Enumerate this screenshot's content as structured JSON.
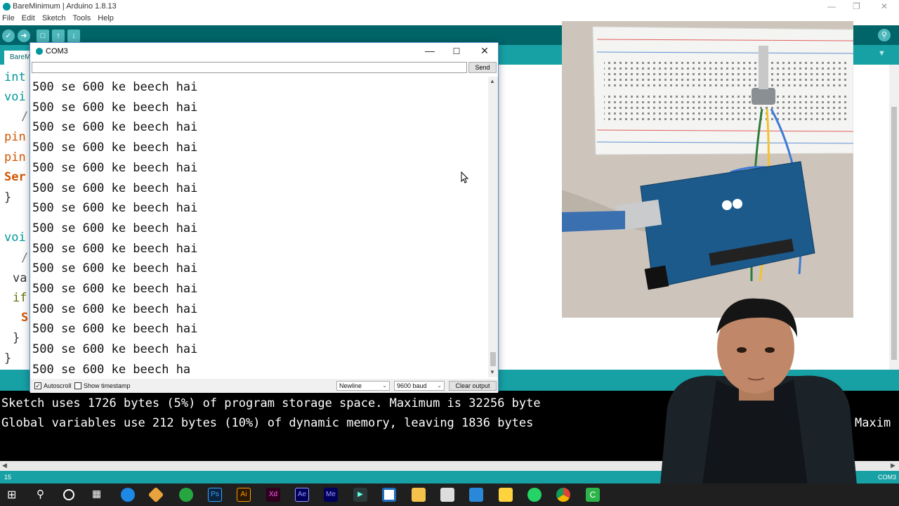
{
  "ide": {
    "window_title": "BareMinimum | Arduino 1.8.13",
    "menu": [
      "File",
      "Edit",
      "Sketch",
      "Tools",
      "Help"
    ],
    "tab_label": "BareMi",
    "code_fragments": [
      "int",
      "voi",
      "/",
      "pin",
      "pin",
      "Ser",
      "}",
      "voi",
      "/",
      "va",
      "if",
      "S",
      "}",
      "}"
    ],
    "console_lines": [
      "Sketch uses 1726 bytes (5%) of program storage space. Maximum is 32256 byte",
      "Global variables use 212 bytes (10%) of dynamic memory, leaving 1836 bytes",
      "Maxim"
    ],
    "status_line_number": "15",
    "status_port": "COM3",
    "accent_color": "#00979c",
    "toolbar_color": "#006468"
  },
  "serial_monitor": {
    "window_title": "COM3",
    "input_value": "",
    "send_label": "Send",
    "output_lines": [
      "500 se 600 ke beech hai",
      "500 se 600 ke beech hai",
      "500 se 600 ke beech hai",
      "500 se 600 ke beech hai",
      "500 se 600 ke beech hai",
      "500 se 600 ke beech hai",
      "500 se 600 ke beech hai",
      "500 se 600 ke beech hai",
      "500 se 600 ke beech hai",
      "500 se 600 ke beech hai",
      "500 se 600 ke beech hai",
      "500 se 600 ke beech hai",
      "500 se 600 ke beech hai",
      "500 se 600 ke beech hai",
      "500 se 600 ke beech ha"
    ],
    "autoscroll_label": "Autoscroll",
    "autoscroll_checked": true,
    "show_timestamp_label": "Show timestamp",
    "show_timestamp_checked": false,
    "line_ending": "Newline",
    "baud_rate": "9600 baud",
    "clear_label": "Clear output"
  },
  "taskbar": {
    "apps": [
      "windows-start",
      "search",
      "cortana",
      "task-view",
      "edge",
      "git",
      "chrome-like",
      "photoshop",
      "illustrator",
      "xd",
      "after-effects",
      "media-encoder",
      "terminal",
      "app-square",
      "file-explorer",
      "store",
      "mail",
      "sticky-notes",
      "whatsapp",
      "chrome",
      "camtasia"
    ]
  }
}
